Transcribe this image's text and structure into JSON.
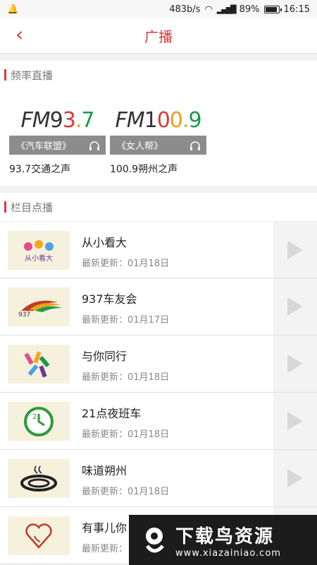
{
  "status_bar": {
    "speed": "483b/s",
    "battery": "89%",
    "time": "16:15"
  },
  "header": {
    "title": "广播",
    "back_glyph": "‹"
  },
  "live_section": {
    "title": "频率直播",
    "channels": [
      {
        "logo_fm": "FM",
        "logo_num": "93.7",
        "name": "《汽车联盟》",
        "desc": "93.7交通之声"
      },
      {
        "logo_fm": "FM",
        "logo_num": "100.9",
        "name": "《女人帮》",
        "desc": "100.9朔州之声"
      }
    ]
  },
  "ondemand_section": {
    "title": "栏目点播",
    "programs": [
      {
        "name": "从小看大",
        "update": "最新更新：01月18日",
        "thumb": "从小看大"
      },
      {
        "name": "937车友会",
        "update": "最新更新：01月17日",
        "thumb": "937"
      },
      {
        "name": "与你同行",
        "update": "最新更新：01月18日",
        "thumb": ""
      },
      {
        "name": "21点夜班车",
        "update": "最新更新：01月18日",
        "thumb": "21"
      },
      {
        "name": "味道朔州",
        "update": "最新更新：01月18日",
        "thumb": ""
      },
      {
        "name": "有事儿你",
        "update": "最新更新：",
        "thumb": ""
      }
    ]
  },
  "watermark": {
    "title": "下载鸟资源",
    "url": "www.xiazainiao.com"
  },
  "colors": {
    "accent": "#d93a3a",
    "channel_bar": "#8c8c8c"
  }
}
